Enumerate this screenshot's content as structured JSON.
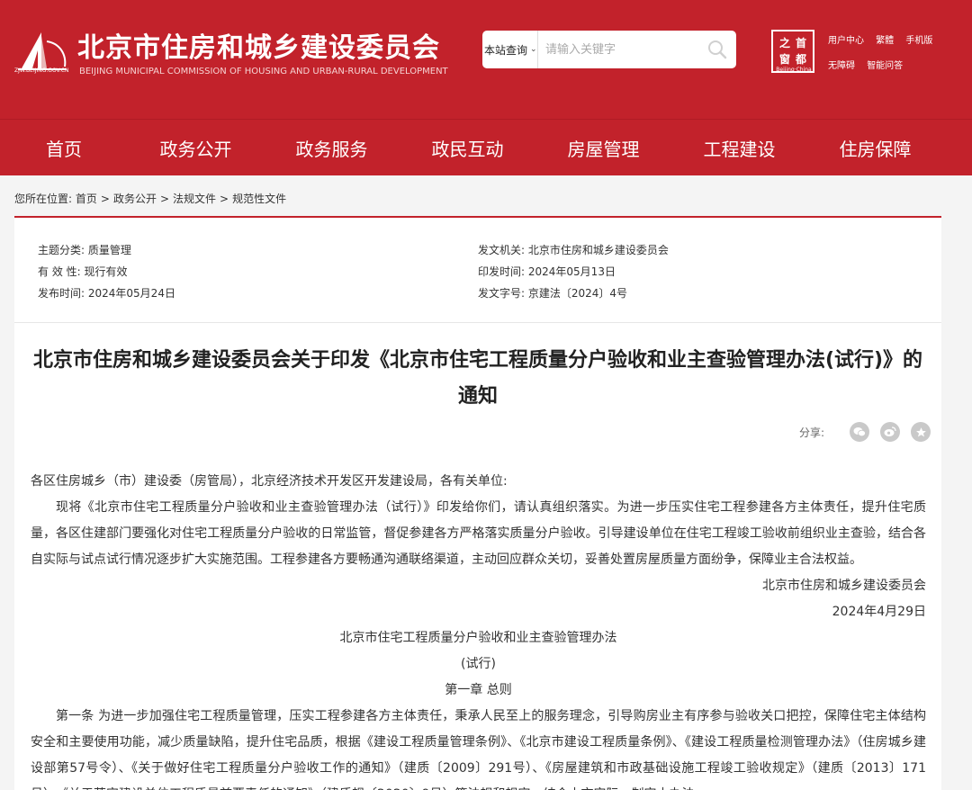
{
  "header": {
    "logo_domain": "ZJW.BEIJING.GOV.CN",
    "site_title": "北京市住房和城乡建设委员会",
    "site_subtitle": "BEIJING MUNICIPAL COMMISSION OF HOUSING AND URBAN-RURAL DEVELOPMENT",
    "search": {
      "scope": "本站查询",
      "placeholder": "请输入关键字"
    },
    "seal": {
      "chars": [
        "之",
        "首",
        "窗",
        "都"
      ],
      "caption": "Beijing·China"
    },
    "tools_row1": [
      "用户中心",
      "繁體",
      "手机版"
    ],
    "tools_row2": [
      "无障碍",
      "智能问答"
    ]
  },
  "nav": [
    "首页",
    "政务公开",
    "政务服务",
    "政民互动",
    "房屋管理",
    "工程建设",
    "住房保障"
  ],
  "breadcrumb": {
    "prefix": "您所在位置:",
    "items": [
      "首页",
      "政务公开",
      "法规文件",
      "规范性文件"
    ],
    "separator": ">"
  },
  "meta": {
    "topic_label": "主题分类:",
    "topic_value": "质量管理",
    "validity_label": "有 效 性:",
    "validity_value": "现行有效",
    "publish_label": "发布时间:",
    "publish_value": "2024年05月24日",
    "issuer_label": "发文机关:",
    "issuer_value": "北京市住房和城乡建设委员会",
    "print_label": "印发时间:",
    "print_value": "2024年05月13日",
    "docno_label": "发文字号:",
    "docno_value": "京建法〔2024〕4号"
  },
  "article": {
    "title": "北京市住房和城乡建设委员会关于印发《北京市住宅工程质量分户验收和业主查验管理办法(试行)》的通知",
    "share_label": "分享:",
    "salutation": "各区住房城乡（市）建设委（房管局），北京经济技术开发区开发建设局，各有关单位:",
    "para1": "现将《北京市住宅工程质量分户验收和业主查验管理办法（试行）》印发给你们，请认真组织落实。为进一步压实住宅工程参建各方主体责任，提升住宅质量，各区住建部门要强化对住宅工程质量分户验收的日常监管，督促参建各方严格落实质量分户验收。引导建设单位在住宅工程竣工验收前组织业主查验，结合各自实际与试点试行情况逐步扩大实施范围。工程参建各方要畅通沟通联络渠道，主动回应群众关切，妥善处置房屋质量方面纷争，保障业主合法权益。",
    "signature": "北京市住房和城乡建设委员会",
    "date": "2024年4月29日",
    "doc_title": "北京市住宅工程质量分户验收和业主查验管理办法",
    "doc_subtitle": "(试行)",
    "chapter": "第一章 总则",
    "article1": "第一条 为进一步加强住宅工程质量管理，压实工程参建各方主体责任，秉承人民至上的服务理念，引导购房业主有序参与验收关口把控，保障住宅主体结构安全和主要使用功能，减少质量缺陷，提升住宅品质，根据《建设工程质量管理条例》、《北京市建设工程质量条例》、《建设工程质量检测管理办法》（住房城乡建设部第57号令）、《关于做好住宅工程质量分户验收工作的通知》（建质〔2009〕291号）、《房屋建筑和市政基础设施工程竣工验收规定》（建质〔2013〕171号）、《关于落实建设单位工程质量首要责任的通知》（建质规〔2020〕9号）等法规和规定，结合本市实际，制定本办法。"
  }
}
